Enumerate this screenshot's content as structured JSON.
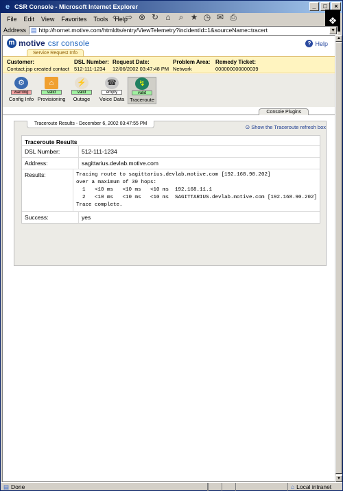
{
  "window": {
    "title": "CSR Console - Microsoft Internet Explorer",
    "minimize": "_",
    "maximize": "□",
    "close": "×"
  },
  "menu": [
    "File",
    "Edit",
    "View",
    "Favorites",
    "Tools",
    "Help"
  ],
  "address": {
    "label": "Address",
    "url": "http://hornet.motive.com/htmldts/entry/ViewTelemetry?incidentId=1&sourceName=tracert"
  },
  "header": {
    "logo_main": "motive",
    "logo_sub": "csr console",
    "help": "Help",
    "section_tab": "Service Request Info"
  },
  "info": [
    {
      "label": "Customer:",
      "value": "Contact.jsp created contact"
    },
    {
      "label": "DSL Number:",
      "value": "512-111-1234"
    },
    {
      "label": "Request Date:",
      "value": "12/06/2002 03:47:48 PM"
    },
    {
      "label": "Problem Area:",
      "value": "Network"
    },
    {
      "label": "Remedy Ticket:",
      "value": "000000000000039"
    }
  ],
  "plugins": [
    {
      "label": "Config Info",
      "badge": "warning",
      "icon": "config-icon",
      "badge_color": "#f4a0a0",
      "active": false
    },
    {
      "label": "Provisioning",
      "badge": "valid",
      "icon": "provisioning-icon",
      "badge_color": "#a0f0a0",
      "active": false
    },
    {
      "label": "Outage",
      "badge": "valid",
      "icon": "outage-icon",
      "badge_color": "#a0f0a0",
      "active": false
    },
    {
      "label": "Voice Data",
      "badge": "empty",
      "icon": "voice-data-icon",
      "badge_color": "#ffffff",
      "active": false
    },
    {
      "label": "Traceroute",
      "badge": "valid",
      "icon": "traceroute-icon",
      "badge_color": "#a0f0a0",
      "active": true
    }
  ],
  "console_plugins_tab": "Console Plugins",
  "panel": {
    "tab": "Traceroute Results - December 6, 2002 03:47:55 PM",
    "refresh_link": "Show the Traceroute refresh box",
    "title": "Traceroute Results",
    "rows": [
      {
        "key": "DSL Number:",
        "value": "512-111-1234"
      },
      {
        "key": "Address:",
        "value": "sagittarius.devlab.motive.com"
      },
      {
        "key": "Results:",
        "value": "Tracing route to sagittarius.devlab.motive.com [192.168.90.202]\nover a maximum of 30 hops:\n  1   <10 ms   <10 ms   <10 ms  192.168.11.1\n  2   <10 ms   <10 ms   <10 ms  SAGITTARIUS.devlab.motive.com [192.168.90.202]\nTrace complete."
      },
      {
        "key": "Success:",
        "value": "yes"
      }
    ]
  },
  "status": {
    "text": "Done",
    "zone": "Local intranet"
  }
}
